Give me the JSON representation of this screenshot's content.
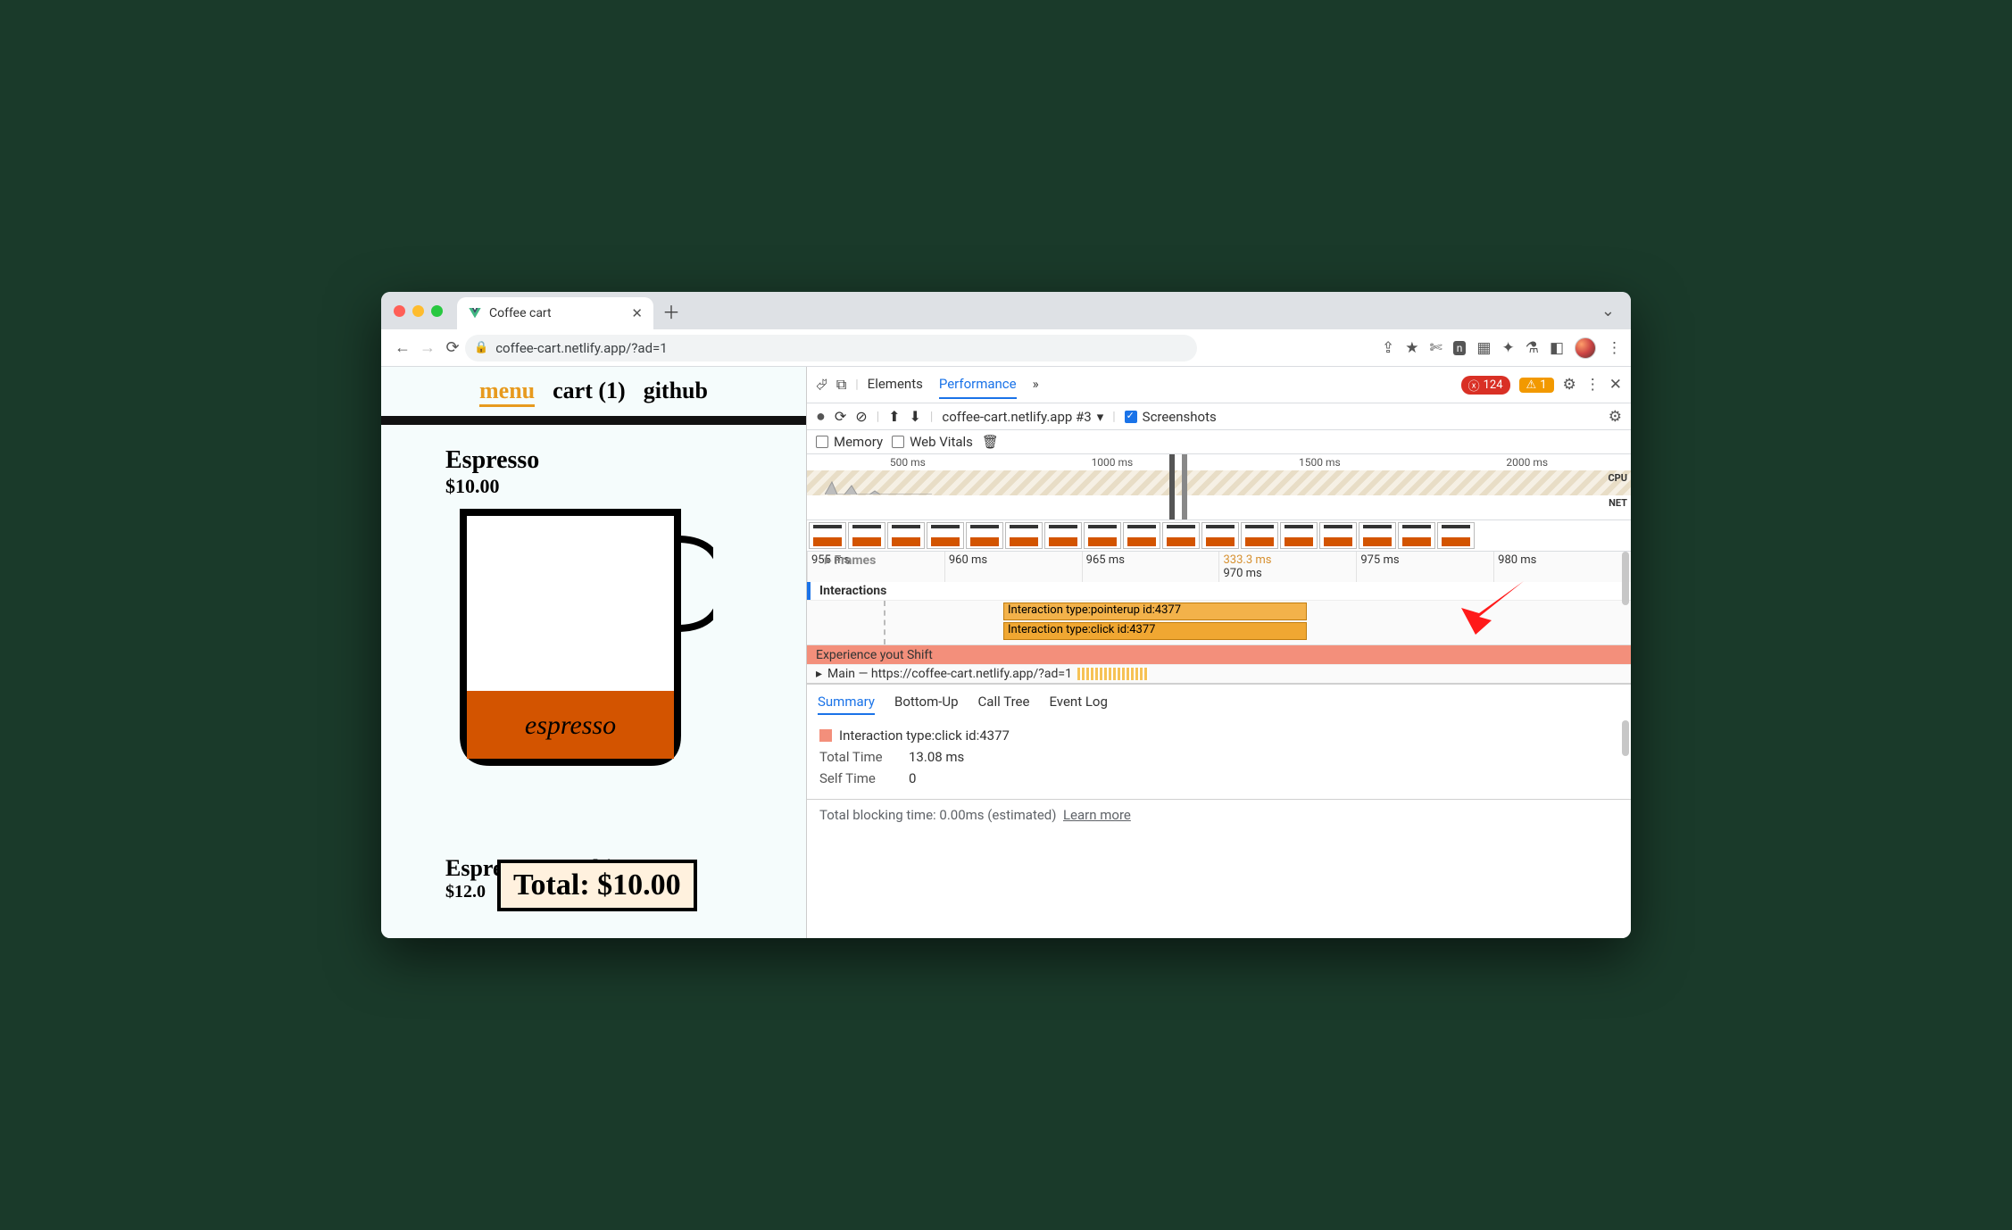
{
  "browser": {
    "tab_title": "Coffee cart",
    "url": "coffee-cart.netlify.app/?ad=1"
  },
  "page": {
    "nav": {
      "menu": "menu",
      "cart": "cart (1)",
      "github": "github"
    },
    "product1": {
      "name": "Espresso",
      "price": "$10.00",
      "fill_label": "espresso"
    },
    "product2": {
      "name": "Espresso Macchiato",
      "price": "$12.0"
    },
    "total_label": "Total: $10.00"
  },
  "devtools": {
    "tabs": {
      "elements": "Elements",
      "performance": "Performance",
      "more": "»"
    },
    "errors": "124",
    "warnings": "1",
    "recording_select": "coffee-cart.netlify.app #3",
    "screenshots_label": "Screenshots",
    "memory_label": "Memory",
    "webvitals_label": "Web Vitals",
    "overview_ticks": [
      "500 ms",
      "1000 ms",
      "1500 ms",
      "2000 ms"
    ],
    "overview_cpu": "CPU",
    "overview_net": "NET",
    "ruler": [
      "955 ms",
      "960 ms",
      "965 ms",
      "970 ms",
      "975 ms",
      "980 ms"
    ],
    "ruler_dim": "333.3 ms",
    "frames_label": "Frames",
    "interactions_label": "Interactions",
    "interaction_bar1": "Interaction type:pointerup id:4377",
    "interaction_bar2": "Interaction type:click id:4377",
    "experience_label": "Experience   yout Shift",
    "main_label": "Main — https://coffee-cart.netlify.app/?ad=1",
    "bottom_tabs": {
      "summary": "Summary",
      "bottomup": "Bottom-Up",
      "calltree": "Call Tree",
      "eventlog": "Event Log"
    },
    "summary": {
      "title": "Interaction type:click id:4377",
      "total_k": "Total Time",
      "total_v": "13.08 ms",
      "self_k": "Self Time",
      "self_v": "0"
    },
    "tbt": "Total blocking time: 0.00ms (estimated)",
    "learn_more": "Learn more"
  }
}
